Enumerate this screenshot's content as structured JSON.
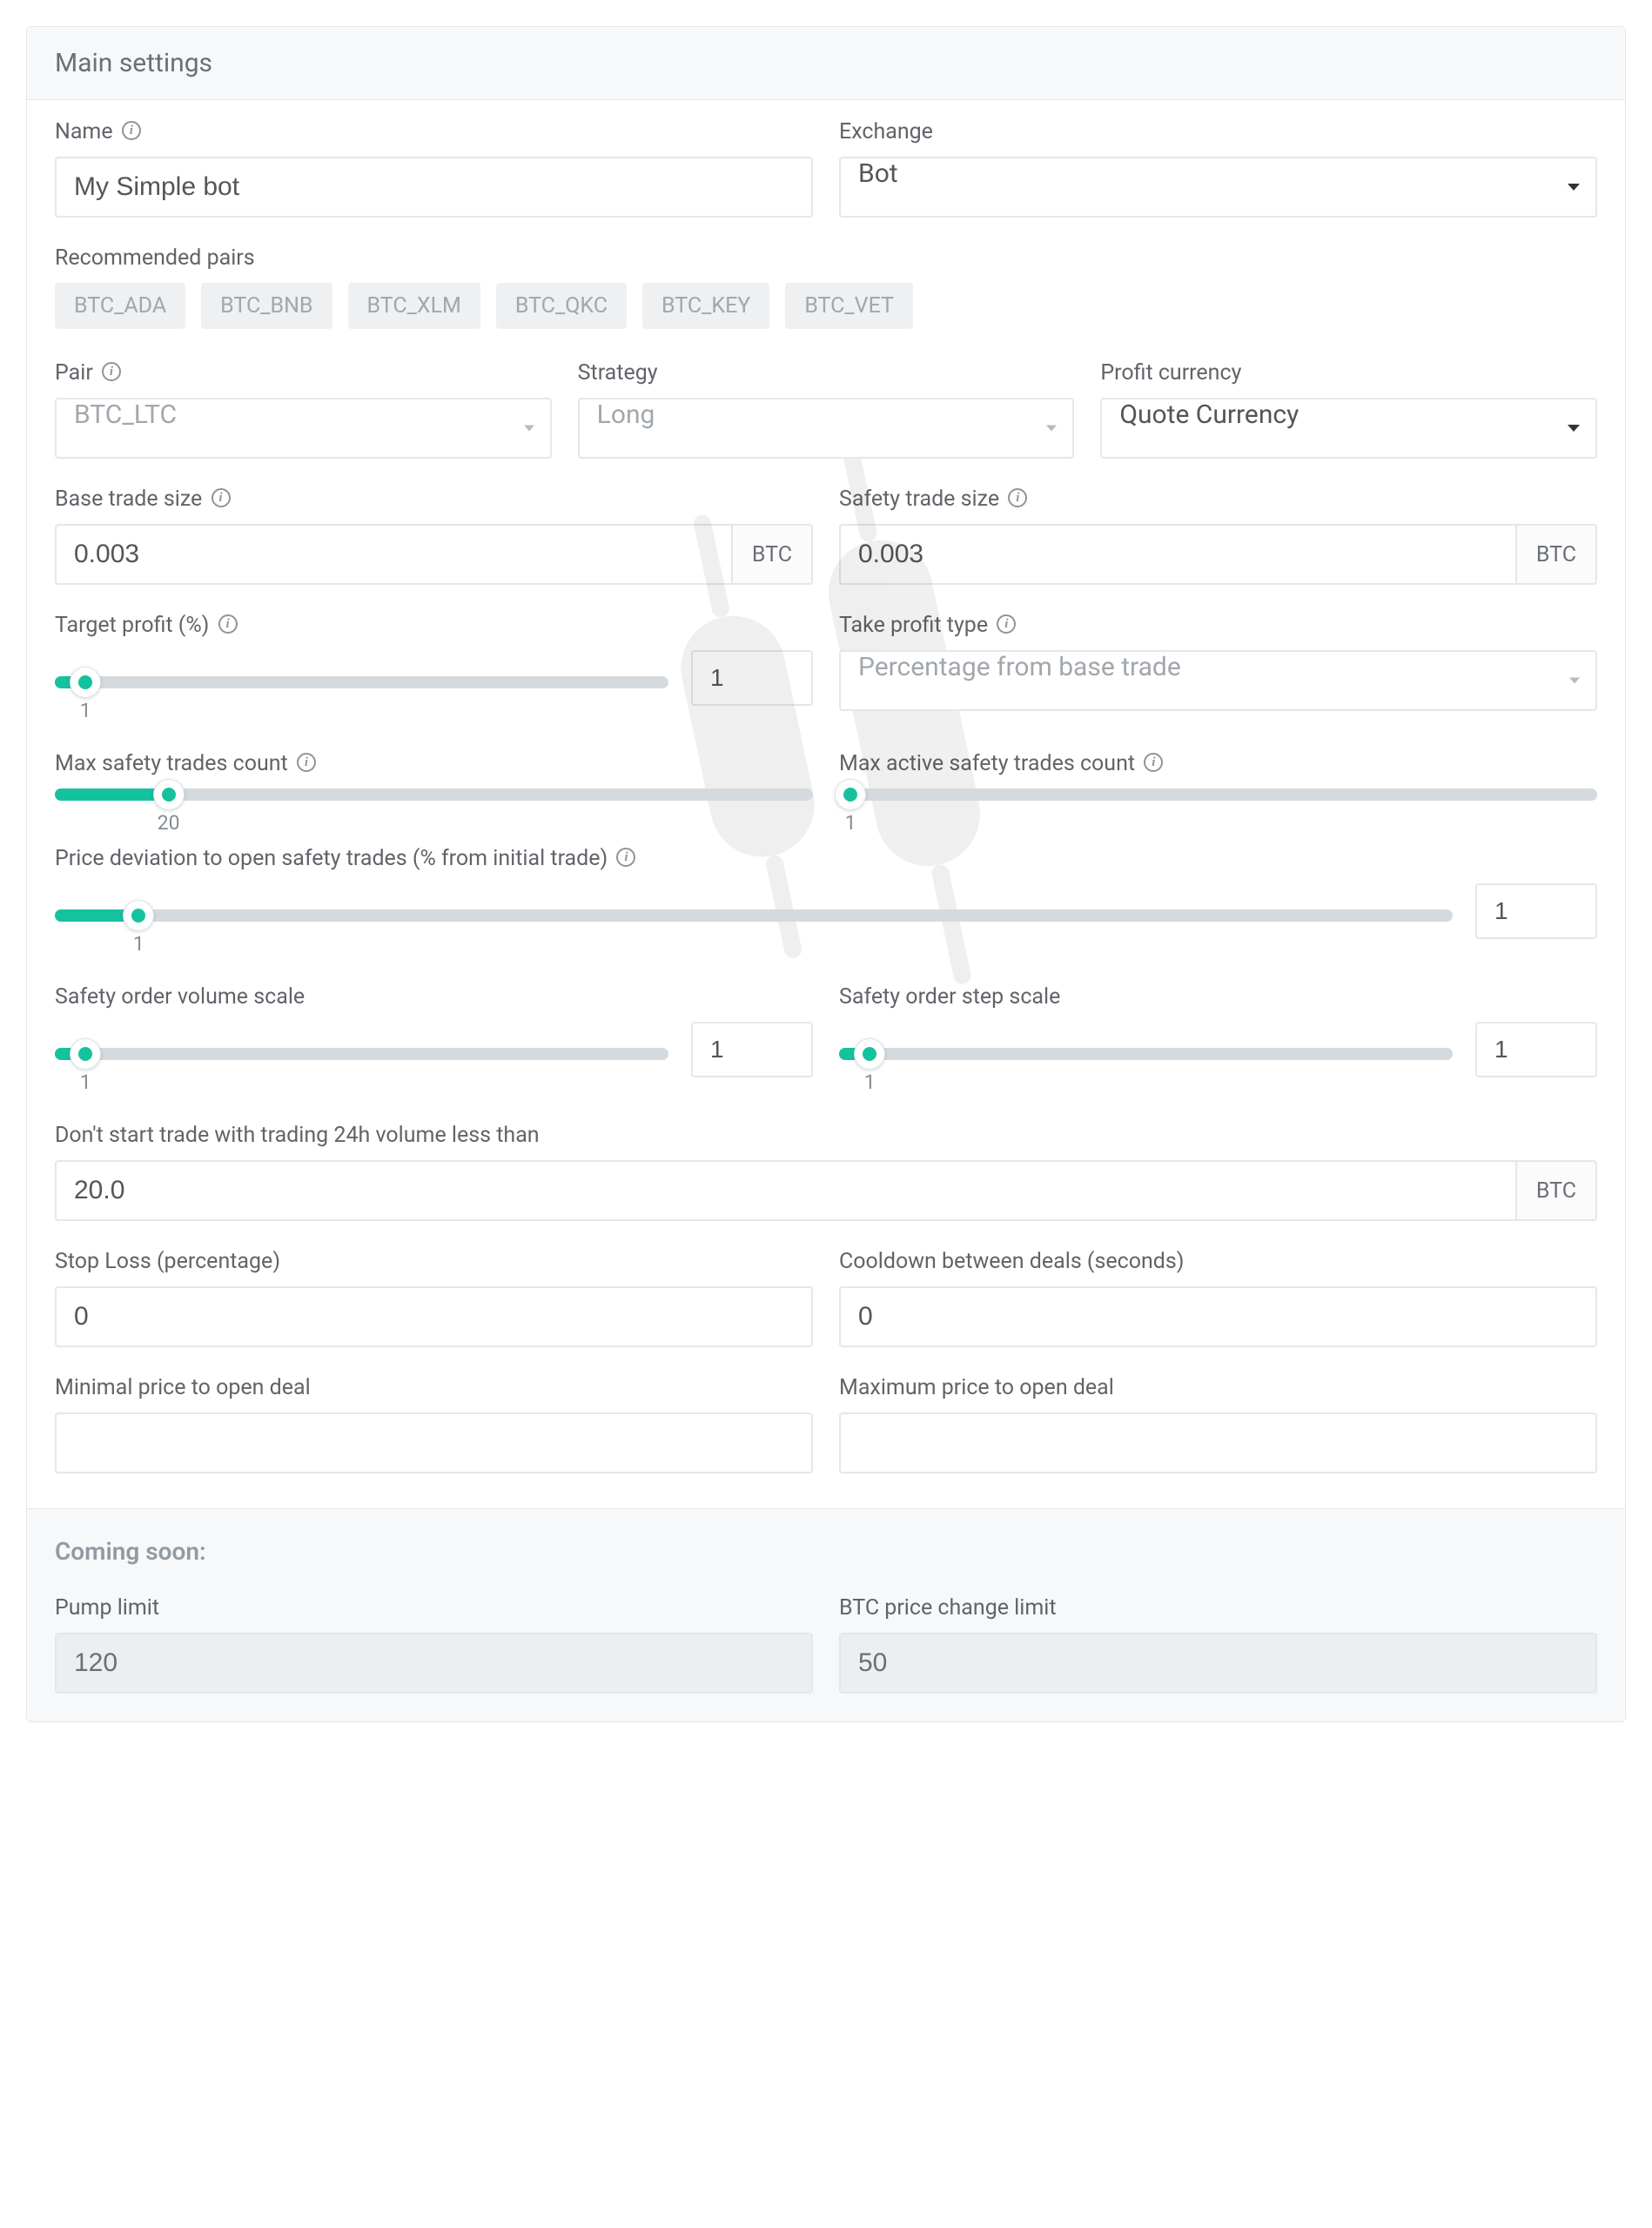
{
  "panel": {
    "title": "Main settings"
  },
  "name": {
    "label": "Name",
    "value": "My Simple bot"
  },
  "exchange": {
    "label": "Exchange",
    "value": "Bot"
  },
  "recommended": {
    "label": "Recommended pairs",
    "items": [
      "BTC_ADA",
      "BTC_BNB",
      "BTC_XLM",
      "BTC_QKC",
      "BTC_KEY",
      "BTC_VET"
    ]
  },
  "pair": {
    "label": "Pair",
    "value": "BTC_LTC"
  },
  "strategy": {
    "label": "Strategy",
    "value": "Long"
  },
  "profit_currency": {
    "label": "Profit currency",
    "value": "Quote Currency"
  },
  "base_trade": {
    "label": "Base trade size",
    "value": "0.003",
    "unit": "BTC"
  },
  "safety_trade": {
    "label": "Safety trade size",
    "value": "0.003",
    "unit": "BTC"
  },
  "target_profit": {
    "label": "Target profit (%)",
    "value": "1",
    "tick": "1",
    "pct": 5
  },
  "take_profit_type": {
    "label": "Take profit type",
    "value": "Percentage from base trade"
  },
  "max_safety": {
    "label": "Max safety trades count",
    "tick": "20",
    "pct": 15
  },
  "max_active_safety": {
    "label": "Max active safety trades count",
    "tick": "1",
    "pct": 1.5
  },
  "price_deviation": {
    "label": "Price deviation to open safety trades (% from initial trade)",
    "value": "1",
    "tick": "1",
    "pct": 6
  },
  "vol_scale": {
    "label": "Safety order volume scale",
    "value": "1",
    "tick": "1",
    "pct": 5
  },
  "step_scale": {
    "label": "Safety order step scale",
    "value": "1",
    "tick": "1",
    "pct": 5
  },
  "min_volume": {
    "label": "Don't start trade with trading 24h volume less than",
    "value": "20.0",
    "unit": "BTC"
  },
  "stop_loss": {
    "label": "Stop Loss (percentage)",
    "value": "0"
  },
  "cooldown": {
    "label": "Cooldown between deals (seconds)",
    "value": "0"
  },
  "min_price": {
    "label": "Minimal price to open deal",
    "value": ""
  },
  "max_price": {
    "label": "Maximum price to open deal",
    "value": ""
  },
  "coming": {
    "title": "Coming soon:",
    "pump": {
      "label": "Pump limit",
      "value": "120"
    },
    "btc": {
      "label": "BTC price change limit",
      "value": "50"
    }
  }
}
